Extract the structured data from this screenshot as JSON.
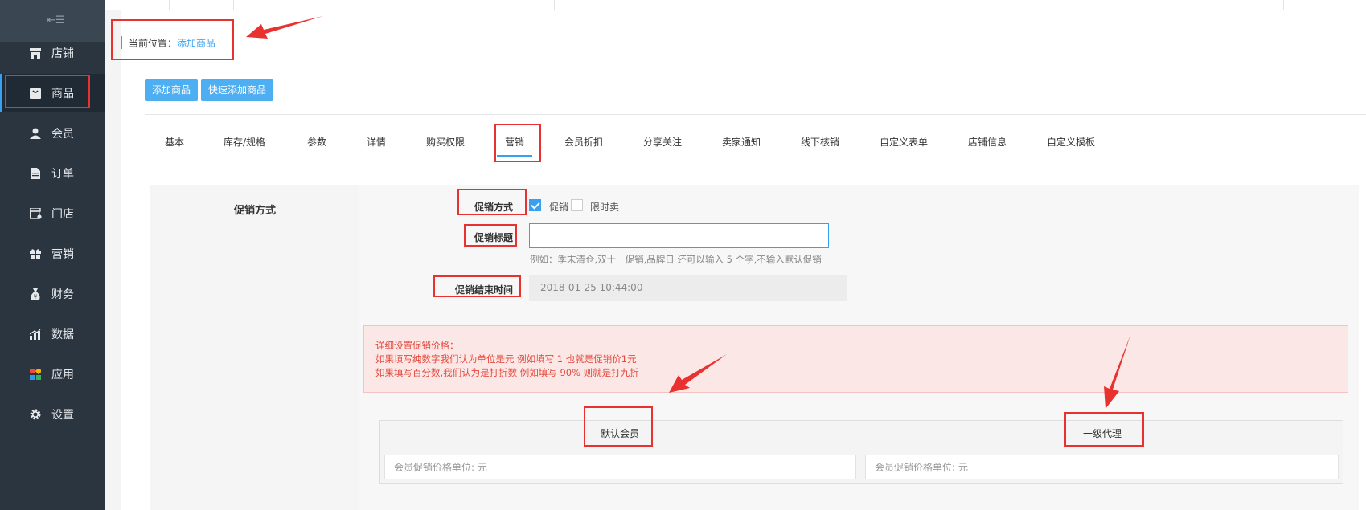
{
  "sidebar": {
    "toggle_icon": "menu-collapse-icon",
    "items": [
      {
        "label": "店铺",
        "icon": "store-icon"
      },
      {
        "label": "商品",
        "icon": "goods-bag-icon",
        "active": true
      },
      {
        "label": "会员",
        "icon": "user-icon"
      },
      {
        "label": "订单",
        "icon": "order-document-icon"
      },
      {
        "label": "门店",
        "icon": "shop-location-icon"
      },
      {
        "label": "营销",
        "icon": "gift-icon"
      },
      {
        "label": "财务",
        "icon": "money-bag-icon"
      },
      {
        "label": "数据",
        "icon": "bar-chart-icon"
      },
      {
        "label": "应用",
        "icon": "apps-grid-icon"
      },
      {
        "label": "设置",
        "icon": "gear-icon"
      }
    ]
  },
  "breadcrumb": {
    "label": "当前位置：",
    "current": "添加商品"
  },
  "actions": {
    "add_goods": "添加商品",
    "quick_add_goods": "快速添加商品"
  },
  "tabs": [
    {
      "label": "基本"
    },
    {
      "label": "库存/规格"
    },
    {
      "label": "参数"
    },
    {
      "label": "详情"
    },
    {
      "label": "购买权限"
    },
    {
      "label": "营销",
      "active": true
    },
    {
      "label": "会员折扣"
    },
    {
      "label": "分享关注"
    },
    {
      "label": "卖家通知"
    },
    {
      "label": "线下核销"
    },
    {
      "label": "自定义表单"
    },
    {
      "label": "店铺信息"
    },
    {
      "label": "自定义模板"
    }
  ],
  "promotion": {
    "section_title": "促销方式",
    "method_label": "促销方式",
    "options": [
      {
        "label": "促销",
        "checked": true
      },
      {
        "label": "限时卖",
        "checked": false
      }
    ],
    "title_label": "促销标题",
    "title_value": "",
    "title_hint": "例如：季末清仓,双十一促销,品牌日 还可以输入 5 个字,不输入默认促销",
    "end_time_label": "促销结束时间",
    "end_time_value": "2018-01-25 10:44:00"
  },
  "alert": {
    "line1": "详细设置促销价格：",
    "line2": "如果填写纯数字我们认为单位是元 例如填写 1 也就是促销价1元",
    "line3": "如果填写百分数,我们认为是打折数 例如填写 90% 则就是打九折"
  },
  "member_table": {
    "columns": [
      "默认会员",
      "一级代理"
    ],
    "placeholders": [
      "会员促销价格单位: 元",
      "会员促销价格单位: 元"
    ]
  },
  "colors": {
    "accent": "#38a0f0",
    "annotation": "#e8322f",
    "alert_text": "#e4493d"
  }
}
